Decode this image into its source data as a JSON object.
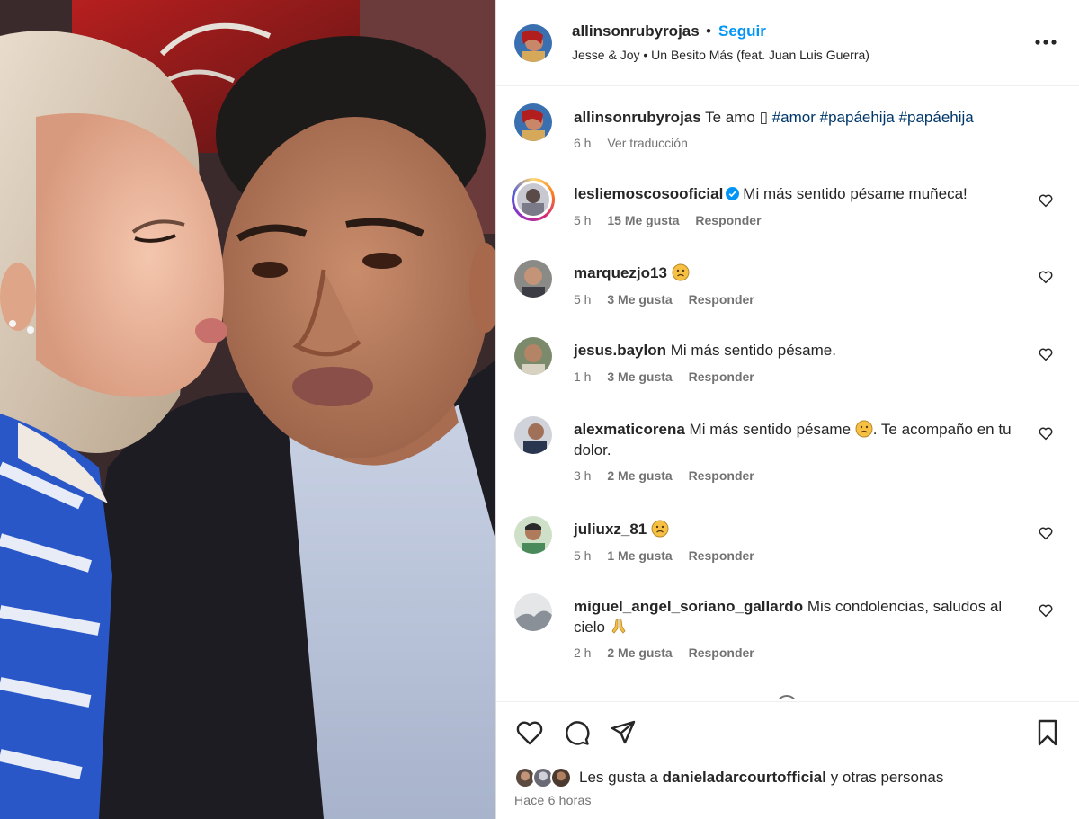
{
  "header": {
    "username": "allinsonrubyrojas",
    "separator": "•",
    "follow_label": "Seguir",
    "song": "Jesse & Joy • Un Besito Más (feat. Juan Luis Guerra)",
    "more_icon": "more-options-icon"
  },
  "caption": {
    "username": "allinsonrubyrojas",
    "text": "Te amo",
    "emoji_placeholder": "▯",
    "hashtags": [
      "#amor",
      "#papáehija",
      "#papáehija"
    ],
    "time": "6 h",
    "translate_label": "Ver traducción"
  },
  "comments": [
    {
      "username": "lesliemoscosooficial",
      "verified": true,
      "text": "Mi más sentido pésame muñeca!",
      "time": "5 h",
      "likes": "15 Me gusta",
      "reply": "Responder"
    },
    {
      "username": "marquezjo13",
      "text": "",
      "emoji": "sad-face",
      "time": "5 h",
      "likes": "3 Me gusta",
      "reply": "Responder"
    },
    {
      "username": "jesus.baylon",
      "text": "Mi más sentido pésame.",
      "time": "1 h",
      "likes": "3 Me gusta",
      "reply": "Responder"
    },
    {
      "username": "alexmaticorena",
      "text": "Mi más sentido pésame",
      "text_after": ". Te acompaño en tu dolor.",
      "emoji": "sad-face",
      "time": "3 h",
      "likes": "2 Me gusta",
      "reply": "Responder"
    },
    {
      "username": "juliuxz_81",
      "text": "",
      "emoji": "sad-face",
      "time": "5 h",
      "likes": "1 Me gusta",
      "reply": "Responder"
    },
    {
      "username": "miguel_angel_soriano_gallardo",
      "text": "Mis condolencias, saludos al cielo",
      "emoji": "praying-hands",
      "time": "2 h",
      "likes": "2 Me gusta",
      "reply": "Responder"
    }
  ],
  "actions": {
    "icons": [
      "heart-icon",
      "comment-icon",
      "share-icon",
      "bookmark-icon"
    ],
    "likes_prefix": "Les gusta a",
    "likes_user": "danieladarcourtofficial",
    "likes_suffix": "y otras personas",
    "time_ago": "Hace 6 horas"
  },
  "colors": {
    "follow": "#0095f6",
    "hashtag": "#00376b",
    "meta": "#737373",
    "verified": "#0095f6",
    "text": "#262626"
  }
}
